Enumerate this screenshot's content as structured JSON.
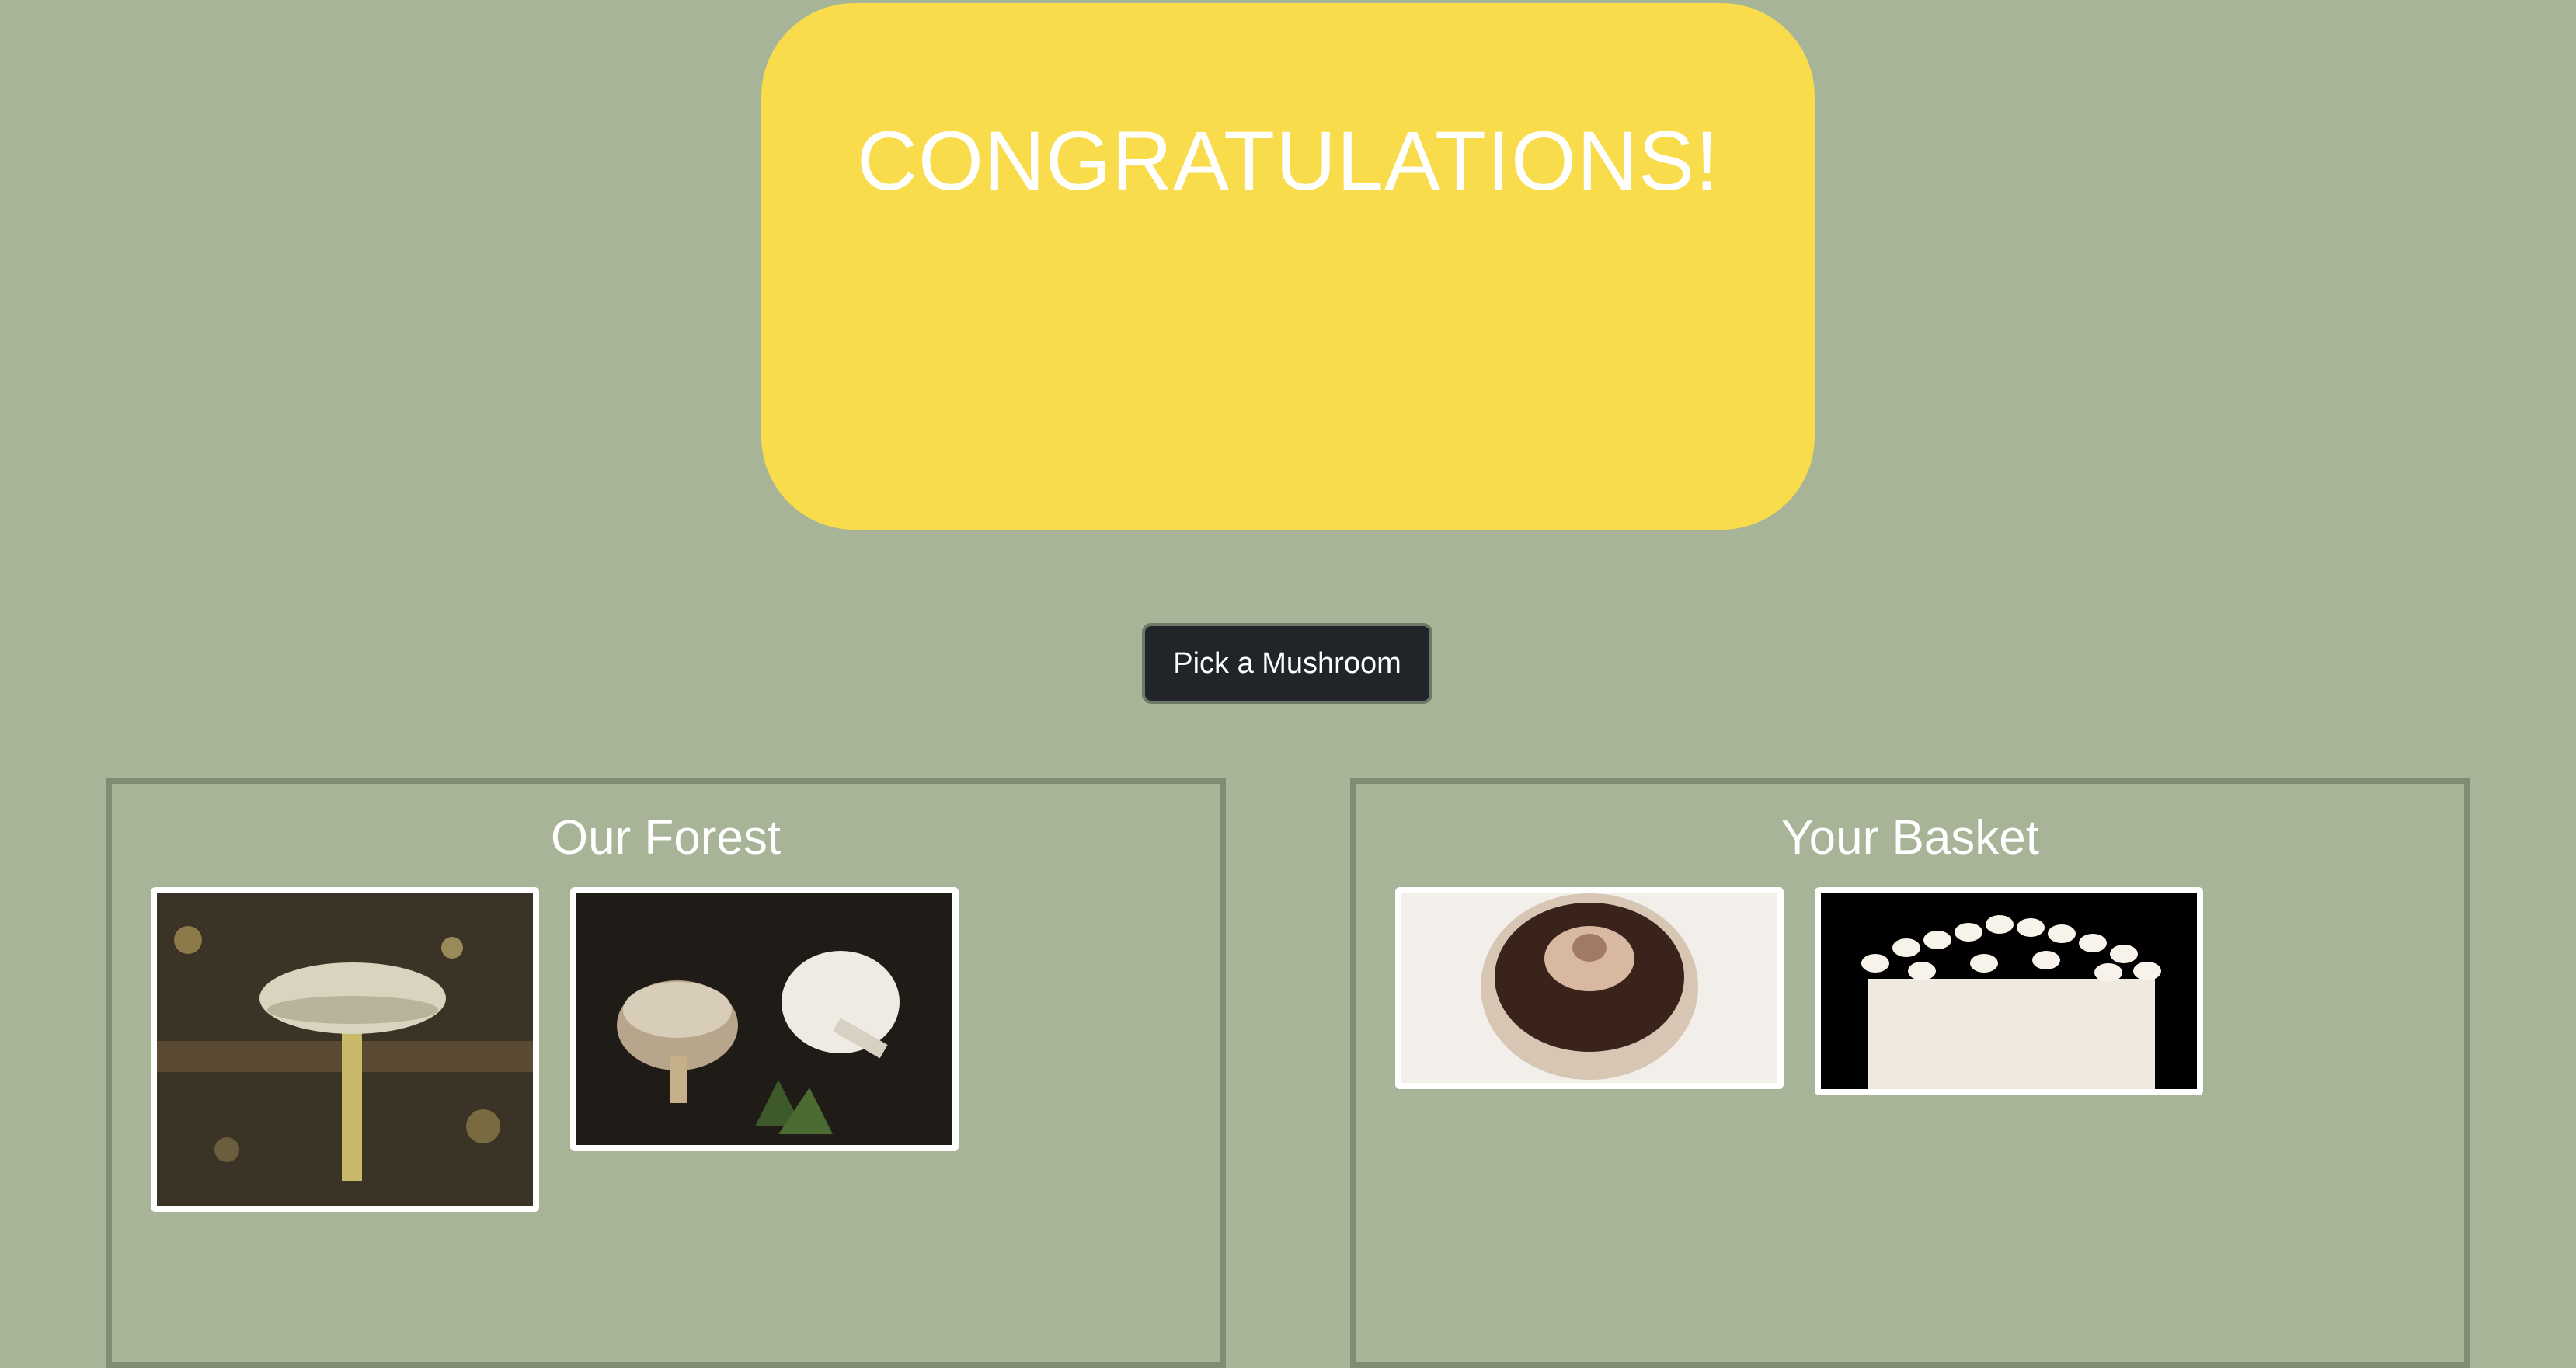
{
  "banner": {
    "title": "CONGRATULATIONS!"
  },
  "actions": {
    "pick_label": "Pick a Mushroom"
  },
  "forest": {
    "title": "Our Forest",
    "items": [
      {
        "name": "pale-capped mushroom on forest floor"
      },
      {
        "name": "two shaggy white mushrooms on dark soil"
      }
    ]
  },
  "basket": {
    "title": "Your Basket",
    "items": [
      {
        "name": "portobello mushroom cap"
      },
      {
        "name": "enoki mushroom cluster"
      }
    ]
  },
  "colors": {
    "background": "#a7b497",
    "banner": "#f9dc4c",
    "button": "#212529",
    "panel_border": "#7f8b72"
  }
}
